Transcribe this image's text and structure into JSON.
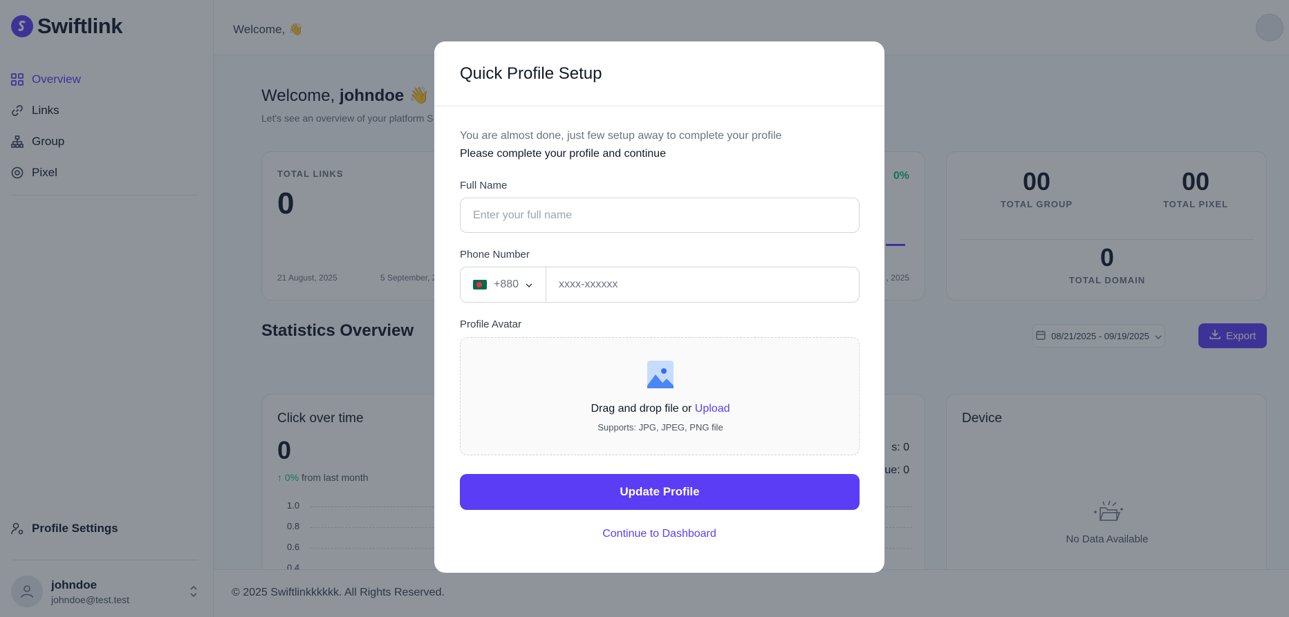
{
  "sidebar": {
    "logo_text": "Swiftlink",
    "items": [
      {
        "label": "Overview",
        "icon": "grid-icon",
        "active": true
      },
      {
        "label": "Links",
        "icon": "link-icon"
      },
      {
        "label": "Group",
        "icon": "hierarchy-icon"
      },
      {
        "label": "Pixel",
        "icon": "target-icon"
      }
    ],
    "profile_settings": "Profile Settings",
    "user": {
      "name": "johndoe",
      "email": "johndoe@test.test"
    }
  },
  "topbar": {
    "welcome": "Welcome, 👋"
  },
  "page": {
    "welcome_prefix": "Welcome,",
    "welcome_name": "johndoe",
    "welcome_emoji": "👋",
    "subtitle": "Let's see an overview of your platform S"
  },
  "total_links": {
    "label": "TOTAL LINKS",
    "value": "0",
    "date_start": "21 August, 2025",
    "date_mid": "5 September, 2",
    "date_end": ", 2025",
    "pct": "0%"
  },
  "totals": {
    "group_value": "00",
    "group_label": "TOTAL GROUP",
    "pixel_value": "00",
    "pixel_label": "TOTAL PIXEL",
    "domain_value": "0",
    "domain_label": "TOTAL DOMAIN"
  },
  "stats": {
    "title": "Statistics Overview",
    "date_range": "08/21/2025 - 09/19/2025",
    "export_label": "Export"
  },
  "click_over_time": {
    "title": "Click over time",
    "value": "0",
    "growth_pct": "0%",
    "growth_text": "from last month",
    "y_ticks": [
      "1.0",
      "0.8",
      "0.6",
      "0.4"
    ],
    "legend_1": "s: 0",
    "legend_2": "ue: 0"
  },
  "device": {
    "title": "Device",
    "empty": "No Data Available"
  },
  "footer": {
    "text": "© 2025 Swiftlinkkkkkk. All Rights Reserved."
  },
  "modal": {
    "title": "Quick Profile Setup",
    "intro": "You are almost done, just few setup away to complete your profile",
    "intro2": "Please complete your profile and continue",
    "full_name_label": "Full Name",
    "full_name_placeholder": "Enter your full name",
    "phone_label": "Phone Number",
    "country_code": "+880",
    "phone_placeholder": "xxxx-xxxxxx",
    "avatar_label": "Profile Avatar",
    "drop_text": "Drag and drop file or",
    "upload_link": "Upload",
    "supports": "Supports: JPG, JPEG, PNG file",
    "update_button": "Update Profile",
    "continue_link": "Continue to Dashboard"
  },
  "colors": {
    "brand": "#5b3df5",
    "positive": "#10b981"
  }
}
